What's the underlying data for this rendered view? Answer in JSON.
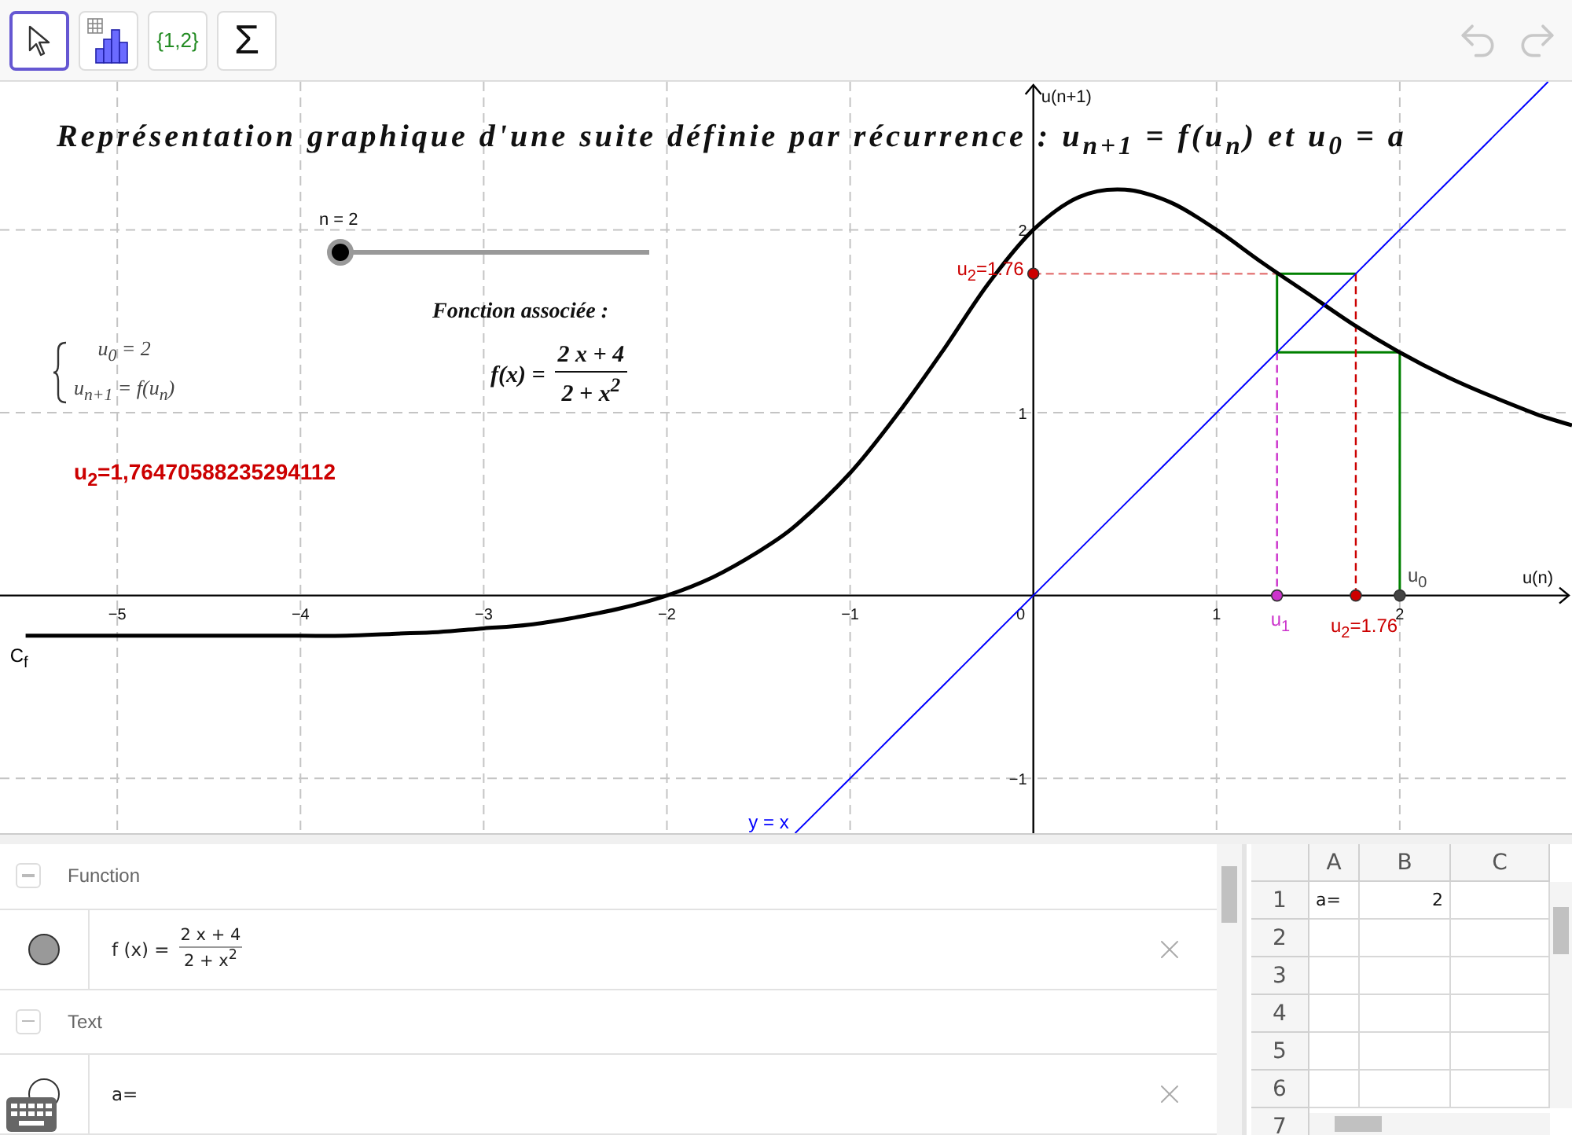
{
  "toolbar": {
    "tools": [
      {
        "kind": "pointer",
        "selected": true
      },
      {
        "kind": "chart",
        "selected": false
      },
      {
        "kind": "text",
        "label": "{1,2}",
        "selected": false
      },
      {
        "kind": "text",
        "label": "Σ",
        "selected": false
      }
    ],
    "undo": {
      "disabled": true
    },
    "redo": {
      "disabled": true
    }
  },
  "graphics": {
    "title": "Représentation graphique d'une suite définie par récurrence  :  u$_{n+1}$ = f(u$_{n}$) et u$_{0}$ = a",
    "slider": {
      "label": "n = 2",
      "level": 0
    },
    "subtitle": "Fonction associée  :",
    "formula": {
      "lhs": "f(x) =",
      "numerator": "2 x + 4",
      "denominator": "2 + x$^{2}$"
    },
    "system": {
      "lines": [
        "u$_{0}$ = 2",
        "u$_{n+1}$ = f(u$_{n}$)"
      ]
    },
    "result": "u$_{2}$=1,76470588235294112",
    "origin_label": "0",
    "chart_data": {
      "type": "line",
      "xlabel": "u(n)",
      "ylabel": "u(n+1)",
      "x": [
        -5.5,
        -5.25,
        -5,
        -4.75,
        -4.5,
        -4.25,
        -4,
        -3.75,
        -3.5,
        -3.25,
        -3,
        -2.75,
        -2.5,
        -2.25,
        -2,
        -1.75,
        -1.5,
        -1.3,
        -1,
        -0.75,
        -0.5,
        -0.25,
        0,
        0.25,
        0.5,
        0.75,
        1,
        1.25,
        1.5,
        1.75,
        2,
        2.25,
        2.5,
        2.75,
        2.81,
        2.94
      ],
      "series": [
        {
          "name": "C$_{f}$",
          "color": "#000000",
          "values": [
            -0.22,
            -0.22,
            -0.22,
            -0.22,
            -0.22,
            -0.22,
            -0.22,
            -0.22,
            -0.21,
            -0.2,
            -0.18,
            -0.16,
            -0.12,
            -0.07,
            0,
            0.1,
            0.24,
            0.38,
            0.67,
            0.98,
            1.33,
            1.7,
            2,
            2.18,
            2.22,
            2.15,
            2,
            1.82,
            1.65,
            1.48,
            1.33,
            1.2,
            1.09,
            0.99,
            0.97,
            0.93
          ]
        },
        {
          "name": "y = x",
          "color": "#0000ff",
          "values": [
            null,
            null,
            null,
            null,
            null,
            null,
            null,
            null,
            null,
            null,
            null,
            null,
            null,
            null,
            null,
            null,
            null,
            -1.3,
            -1,
            -0.75,
            -0.5,
            -0.25,
            0,
            0.25,
            0.5,
            0.75,
            1,
            1.25,
            1.5,
            1.75,
            2,
            2.25,
            2.5,
            2.75,
            2.81,
            null
          ]
        }
      ],
      "xlim": [
        -5.64,
        2.94
      ],
      "ylim": [
        -1.3,
        2.81
      ],
      "grid": true,
      "xticks": [
        {
          "value": -5,
          "label": "−5"
        },
        {
          "value": -4,
          "label": "−4"
        },
        {
          "value": -3,
          "label": "−3"
        },
        {
          "value": -2,
          "label": "−2"
        },
        {
          "value": -1,
          "label": "−1"
        },
        {
          "value": 1,
          "label": "1"
        },
        {
          "value": 2,
          "label": "2"
        }
      ],
      "yticks": [
        {
          "value": -1,
          "label": "−1"
        },
        {
          "value": 1,
          "label": "1"
        },
        {
          "value": 2,
          "label": "2"
        }
      ],
      "annotations": [
        {
          "x": 2,
          "y": 0,
          "text": "u$_{0}$"
        },
        {
          "x": 1.33,
          "y": 0,
          "text": "u$_{1}$"
        },
        {
          "x": 1.76,
          "y": 0,
          "text": "u$_{2}$=1.76"
        },
        {
          "x": 0,
          "y": 1.76,
          "text": "u$_{2}$=1.76"
        }
      ]
    }
  },
  "algebra": {
    "groups": [
      {
        "title": "Function",
        "expanded": true,
        "items": [
          {
            "kind": "fraction",
            "visible": true,
            "lhs": "f (x) =",
            "numerator": "2 x + 4",
            "denominator": "2 + x$^{2}$"
          }
        ]
      },
      {
        "title": "Text",
        "expanded": true,
        "items": [
          {
            "kind": "plain",
            "visible": false,
            "value": "a="
          }
        ]
      }
    ]
  },
  "spreadsheet": {
    "columns": [
      "A",
      "B",
      "C"
    ],
    "rows": [
      {
        "label": "1",
        "values": {
          "A": {
            "text": "a=",
            "kind": "text"
          },
          "B": {
            "text": "2",
            "kind": "number"
          }
        }
      },
      {
        "label": "2"
      },
      {
        "label": "3"
      },
      {
        "label": "4"
      },
      {
        "label": "5"
      },
      {
        "label": "6"
      },
      {
        "label": "7"
      }
    ]
  }
}
